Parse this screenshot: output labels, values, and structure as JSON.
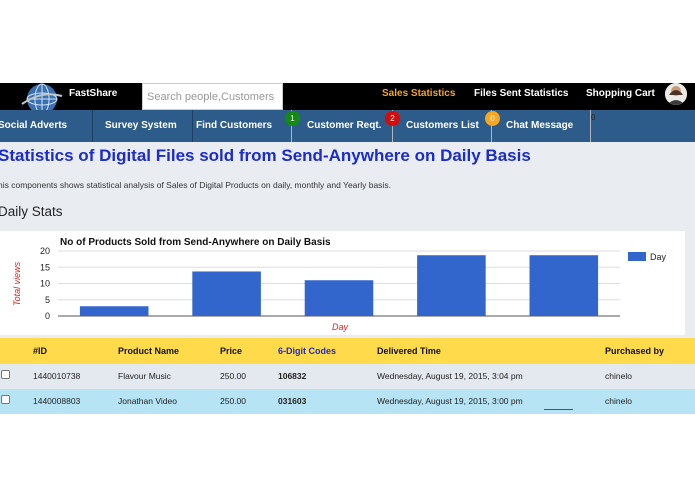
{
  "header": {
    "brand": "FastShare",
    "search_placeholder": "Search people,Customers",
    "links": [
      "Sales Statistics",
      "Files Sent Statistics",
      "Shopping Cart"
    ]
  },
  "nav": {
    "items": [
      "Social Adverts",
      "Survey System",
      "Find Customers",
      "Customer Reqt.",
      "Customers List",
      "Chat Message"
    ],
    "badges": [
      "1",
      "2",
      "0"
    ],
    "stray": "0"
  },
  "main": {
    "title": "Statistics of Digital Files sold from Send-Anywhere on Daily Basis",
    "description": "his components shows statistical analysis of Sales of Digital Products on daily, monthly and Yearly basis.",
    "section_title": "Daily Stats"
  },
  "chart_data": {
    "type": "bar",
    "title": "No of Products Sold from Send-Anywhere on Daily Basis",
    "xlabel": "Day",
    "ylabel": "Total views",
    "ylim": [
      0,
      20
    ],
    "yticks": [
      "0",
      "5",
      "10",
      "15",
      "20"
    ],
    "categories": [
      "",
      "",
      "",
      "",
      ""
    ],
    "series": [
      {
        "name": "Day",
        "values": [
          3,
          13.7,
          11,
          18.7,
          18.7
        ]
      }
    ],
    "grid": true,
    "legend": "right"
  },
  "table": {
    "headers": [
      "#ID",
      "Product Name",
      "Price",
      "6-Digit Codes",
      "Delivered Time",
      "Purchased by"
    ],
    "rows": [
      [
        "1440010738",
        "Flavour Music",
        "250.00",
        "106832",
        "Wednesday, August 19, 2015, 3:04 pm",
        "chinelo"
      ],
      [
        "1440008803",
        "Jonathan Video",
        "250.00",
        "031603",
        "Wednesday, August 19, 2015, 3:00 pm",
        "chinelo"
      ]
    ]
  },
  "colors": {
    "topbar": "#000000",
    "navbar": "#2d5c8a",
    "title": "#1b2bcc",
    "active_link": "#f5a623",
    "bar": "#3366cc",
    "thead": "#ffda4a",
    "row_alt": "#b6e4f5"
  }
}
